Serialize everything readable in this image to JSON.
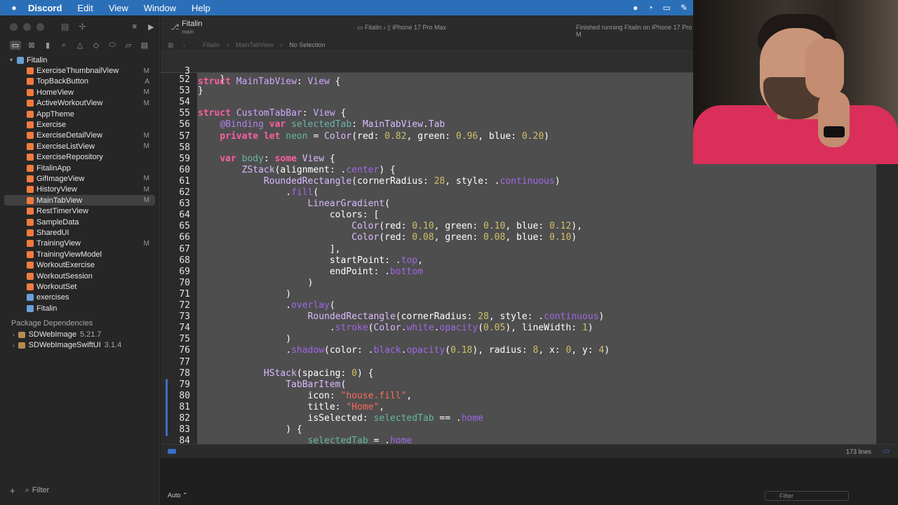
{
  "menubar": {
    "app": "Discord",
    "items": [
      "Edit",
      "View",
      "Window",
      "Help"
    ]
  },
  "project": {
    "title": "Fitalin",
    "subtitle": "main"
  },
  "scheme": {
    "target": "Fitalin",
    "device": "iPhone 17 Pro Max"
  },
  "status_text": "Finished running Fitalin on iPhone 17 Pro M",
  "jumpbar": {
    "items": [
      "Fitalin",
      "MainTabView"
    ],
    "current": "No Selection"
  },
  "navigator": {
    "root": "Fitalin",
    "files": [
      {
        "name": "ExerciseThumbnailView",
        "badge": "M"
      },
      {
        "name": "TopBackButton",
        "badge": "A"
      },
      {
        "name": "HomeView",
        "badge": "M"
      },
      {
        "name": "ActiveWorkoutView",
        "badge": "M"
      },
      {
        "name": "AppTheme",
        "badge": ""
      },
      {
        "name": "Exercise",
        "badge": ""
      },
      {
        "name": "ExerciseDetailView",
        "badge": "M"
      },
      {
        "name": "ExerciseListView",
        "badge": "M"
      },
      {
        "name": "ExerciseRepository",
        "badge": ""
      },
      {
        "name": "FitalinApp",
        "badge": ""
      },
      {
        "name": "GifImageView",
        "badge": "M"
      },
      {
        "name": "HistoryView",
        "badge": "M"
      },
      {
        "name": "MainTabView",
        "badge": "M",
        "selected": true
      },
      {
        "name": "RestTimerView",
        "badge": ""
      },
      {
        "name": "SampleData",
        "badge": ""
      },
      {
        "name": "SharedUI",
        "badge": ""
      },
      {
        "name": "TrainingView",
        "badge": "M"
      },
      {
        "name": "TrainingViewModel",
        "badge": ""
      },
      {
        "name": "WorkoutExercise",
        "badge": ""
      },
      {
        "name": "WorkoutSession",
        "badge": ""
      },
      {
        "name": "WorkoutSet",
        "badge": ""
      },
      {
        "name": "exercises",
        "badge": ""
      },
      {
        "name": "Fitalin",
        "badge": ""
      }
    ],
    "packages_header": "Package Dependencies",
    "packages": [
      {
        "name": "SDWebImage",
        "version": "5.21.7"
      },
      {
        "name": "SDWebImageSwiftUI",
        "version": "3.1.4"
      }
    ],
    "filter_placeholder": "Filter"
  },
  "editor": {
    "sticky_line": {
      "num": "3",
      "html": "<span class='kw'>struct</span> <span class='ty'>MainTabView</span>: <span class='ty'>View</span> {"
    },
    "lines": [
      {
        "num": "52",
        "html": "    }"
      },
      {
        "num": "53",
        "html": "}"
      },
      {
        "num": "54",
        "html": ""
      },
      {
        "num": "55",
        "html": "<span class='kw'>struct</span> <span class='ty'>CustomTabBar</span>: <span class='ty'>View</span> {"
      },
      {
        "num": "56",
        "html": "    <span class='cm'>@Binding</span> <span class='kw'>var</span> <span class='pr'>selectedTab</span>: <span class='ty2'>MainTabView</span>.<span class='ty2'>Tab</span>"
      },
      {
        "num": "57",
        "html": "    <span class='kw'>private</span> <span class='kw'>let</span> <span class='pr'>neon</span> = <span class='ty2'>Color</span>(red: <span class='nu'>0.82</span>, green: <span class='nu'>0.96</span>, blue: <span class='nu'>0.20</span>)"
      },
      {
        "num": "58",
        "html": ""
      },
      {
        "num": "59",
        "html": "    <span class='kw'>var</span> <span class='pr'>body</span>: <span class='kw'>some</span> <span class='ty2'>View</span> {"
      },
      {
        "num": "60",
        "html": "        <span class='ty2'>ZStack</span>(alignment: .<span class='mb'>center</span>) {"
      },
      {
        "num": "61",
        "html": "            <span class='ty2'>RoundedRectangle</span>(cornerRadius: <span class='nu'>28</span>, style: .<span class='mb'>continuous</span>)"
      },
      {
        "num": "62",
        "html": "                .<span class='mb'>fill</span>("
      },
      {
        "num": "63",
        "html": "                    <span class='ty2'>LinearGradient</span>("
      },
      {
        "num": "64",
        "html": "                        colors: ["
      },
      {
        "num": "65",
        "html": "                            <span class='ty2'>Color</span>(red: <span class='nu'>0.10</span>, green: <span class='nu'>0.10</span>, blue: <span class='nu'>0.12</span>),"
      },
      {
        "num": "66",
        "html": "                            <span class='ty2'>Color</span>(red: <span class='nu'>0.08</span>, green: <span class='nu'>0.08</span>, blue: <span class='nu'>0.10</span>)"
      },
      {
        "num": "67",
        "html": "                        ],"
      },
      {
        "num": "68",
        "html": "                        startPoint: .<span class='mb'>top</span>,"
      },
      {
        "num": "69",
        "html": "                        endPoint: .<span class='mb'>bottom</span>"
      },
      {
        "num": "70",
        "html": "                    )"
      },
      {
        "num": "71",
        "html": "                )"
      },
      {
        "num": "72",
        "html": "                .<span class='mb'>overlay</span>("
      },
      {
        "num": "73",
        "html": "                    <span class='ty2'>RoundedRectangle</span>(cornerRadius: <span class='nu'>28</span>, style: .<span class='mb'>continuous</span>)"
      },
      {
        "num": "74",
        "html": "                        .<span class='mb'>stroke</span>(<span class='ty2'>Color</span>.<span class='mb'>white</span>.<span class='mb'>opacity</span>(<span class='nu'>0.05</span>), lineWidth: <span class='nu'>1</span>)"
      },
      {
        "num": "75",
        "html": "                )"
      },
      {
        "num": "76",
        "html": "                .<span class='mb'>shadow</span>(color: .<span class='mb'>black</span>.<span class='mb'>opacity</span>(<span class='nu'>0.18</span>), radius: <span class='nu'>8</span>, x: <span class='nu'>0</span>, y: <span class='nu'>4</span>)"
      },
      {
        "num": "77",
        "html": ""
      },
      {
        "num": "78",
        "html": "            <span class='ty2'>HStack</span>(spacing: <span class='nu'>0</span>) {"
      },
      {
        "num": "79",
        "html": "                <span class='ty2'>TabBarItem</span>("
      },
      {
        "num": "80",
        "html": "                    icon: <span class='st'>\"house.fill\"</span>,"
      },
      {
        "num": "81",
        "html": "                    title: <span class='st'>\"Home\"</span>,"
      },
      {
        "num": "82",
        "html": "                    isSelected: <span class='pr'>selectedTab</span> == .<span class='mb'>home</span>"
      },
      {
        "num": "83",
        "html": "                ) {"
      },
      {
        "num": "84",
        "html": "                    <span class='pr'>selectedTab</span> = .<span class='mb'>home</span>"
      }
    ]
  },
  "bottombar": {
    "lines_count": "173 lines"
  },
  "debug": {
    "mode": "Auto",
    "filter_placeholder": "Filter"
  }
}
